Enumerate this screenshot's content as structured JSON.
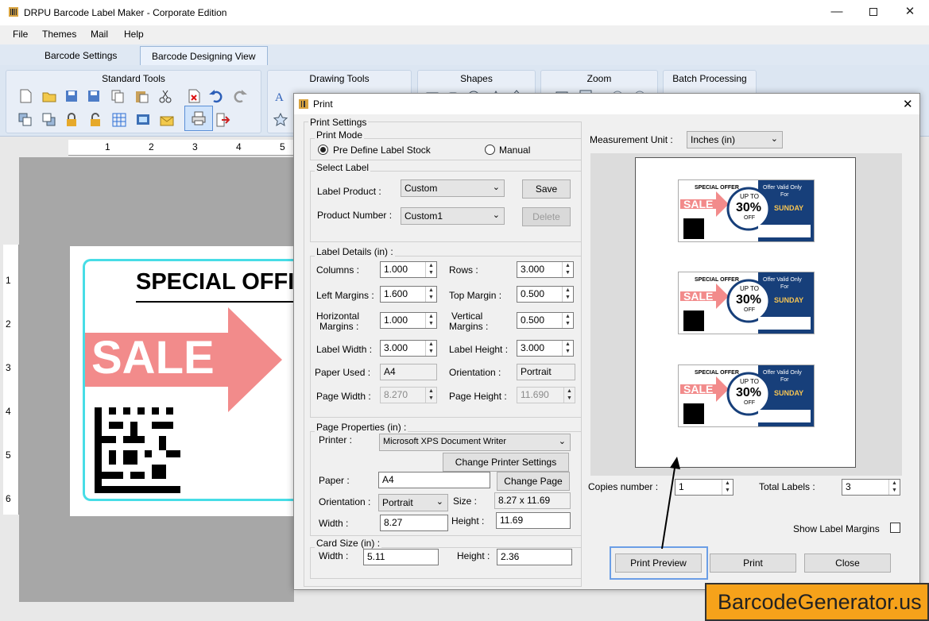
{
  "window": {
    "title": "DRPU Barcode Label Maker - Corporate Edition"
  },
  "menu": [
    "File",
    "Themes",
    "Mail",
    "Help"
  ],
  "tabs": [
    "Barcode Settings",
    "Barcode Designing View"
  ],
  "ribbon": {
    "groups": [
      "Standard Tools",
      "Drawing Tools",
      "Shapes",
      "Zoom",
      "Batch Processing"
    ]
  },
  "ruler": {
    "h": [
      "1",
      "2",
      "3",
      "4",
      "5"
    ],
    "v": [
      "1",
      "2",
      "3",
      "4",
      "5",
      "6"
    ]
  },
  "canvas_label": {
    "heading": "SPECIAL OFFI",
    "sale": "SALE"
  },
  "dialog": {
    "title": "Print",
    "print_settings": "Print Settings",
    "print_mode": {
      "legend": "Print Mode",
      "option_predefine": "Pre Define Label Stock",
      "option_manual": "Manual"
    },
    "select_label": {
      "legend": "Select Label",
      "label_product_label": "Label Product :",
      "label_product_value": "Custom",
      "product_number_label": "Product Number :",
      "product_number_value": "Custom1",
      "save": "Save",
      "delete": "Delete"
    },
    "label_details": {
      "legend": "Label Details (in) :",
      "columns_label": "Columns :",
      "columns": "1.000",
      "rows_label": "Rows :",
      "rows": "3.000",
      "left_margins_label": "Left Margins :",
      "left_margins": "1.600",
      "top_margin_label": "Top Margin :",
      "top_margin": "0.500",
      "h_margins_label1": "Horizontal",
      "h_margins_label2": "Margins :",
      "h_margins": "1.000",
      "v_margins_label1": "Vertical",
      "v_margins_label2": "Margins :",
      "v_margins": "0.500",
      "label_width_label": "Label Width :",
      "label_width": "3.000",
      "label_height_label": "Label Height :",
      "label_height": "3.000",
      "paper_used_label": "Paper Used :",
      "paper_used": "A4",
      "orientation_label": "Orientation :",
      "orientation": "Portrait",
      "page_width_label": "Page Width :",
      "page_width": "8.270",
      "page_height_label": "Page Height :",
      "page_height": "11.690"
    },
    "page_properties": {
      "legend": "Page Properties (in) :",
      "printer_label": "Printer :",
      "printer": "Microsoft XPS Document Writer",
      "change_printer": "Change Printer Settings",
      "paper_label": "Paper :",
      "paper": "A4",
      "change_page": "Change Page",
      "orientation_label": "Orientation :",
      "orientation": "Portrait",
      "size_label": "Size :",
      "size": "8.27 x 11.69",
      "width_label": "Width :",
      "width": "8.27",
      "height_label": "Height :",
      "height": "11.69"
    },
    "card_size": {
      "legend": "Card Size (in) :",
      "width_label": "Width :",
      "width": "5.11",
      "height_label": "Height :",
      "height": "2.36"
    },
    "measurement_unit_label": "Measurement Unit :",
    "measurement_unit": "Inches (in)",
    "copies_label": "Copies number :",
    "copies": "1",
    "total_labels_label": "Total Labels :",
    "total_labels": "3",
    "show_margins": "Show Label Margins",
    "buttons": {
      "preview": "Print Preview",
      "print": "Print",
      "close": "Close"
    },
    "mini_label": {
      "special": "SPECIAL OFFER",
      "sale": "SALE",
      "upto": "UP TO",
      "pct": "30%",
      "off": "OFF",
      "valid1": "Offer Valid Only",
      "valid2": "For",
      "day": "SUNDAY"
    }
  },
  "watermark": "BarcodeGenerator.us",
  "colors": {
    "accent": "#1f64c4",
    "cyan": "#47dde6",
    "sale": "#f28b8b",
    "navy": "#173f7a",
    "watermark": "#f6a21a"
  }
}
